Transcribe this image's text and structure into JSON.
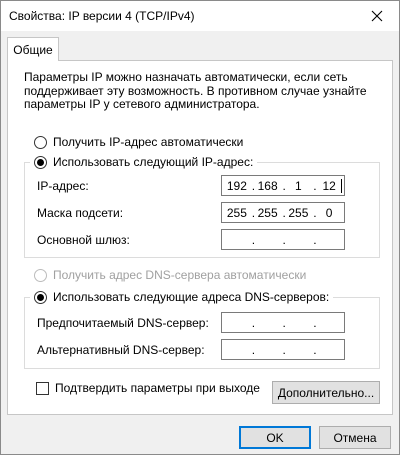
{
  "window": {
    "title": "Свойства: IP версии 4 (TCP/IPv4)",
    "close_label": "×"
  },
  "tabs": [
    {
      "label": "Общие"
    }
  ],
  "description": "Параметры IP можно назначать автоматически, если сеть поддерживает эту возможность. В противном случае узнайте параметры IP у сетевого администратора.",
  "ip_mode": {
    "auto_label": "Получить IP-адрес автоматически",
    "manual_label": "Использовать следующий IP-адрес:",
    "selected": "manual"
  },
  "ip_fields": {
    "ip_address": {
      "label": "IP-адрес:",
      "octets": [
        "192",
        "168",
        "1",
        "12"
      ]
    },
    "subnet_mask": {
      "label": "Маска подсети:",
      "octets": [
        "255",
        "255",
        "255",
        "0"
      ]
    },
    "gateway": {
      "label": "Основной шлюз:",
      "octets": [
        "",
        "",
        "",
        ""
      ]
    }
  },
  "dns_mode": {
    "auto_label": "Получить адрес DNS-сервера автоматически",
    "manual_label": "Использовать следующие адреса DNS-серверов:",
    "selected": "manual"
  },
  "dns_fields": {
    "preferred": {
      "label": "Предпочитаемый DNS-сервер:",
      "octets": [
        "",
        "",
        "",
        ""
      ]
    },
    "alternate": {
      "label": "Альтернативный DNS-сервер:",
      "octets": [
        "",
        "",
        "",
        ""
      ]
    }
  },
  "validate": {
    "label": "Подтвердить параметры при выходе",
    "checked": false
  },
  "buttons": {
    "advanced": "Дополнительно...",
    "ok": "OK",
    "cancel": "Отмена"
  },
  "colors": {
    "default_button_border": "#0078d7",
    "disabled_text": "#a0a0a0"
  }
}
